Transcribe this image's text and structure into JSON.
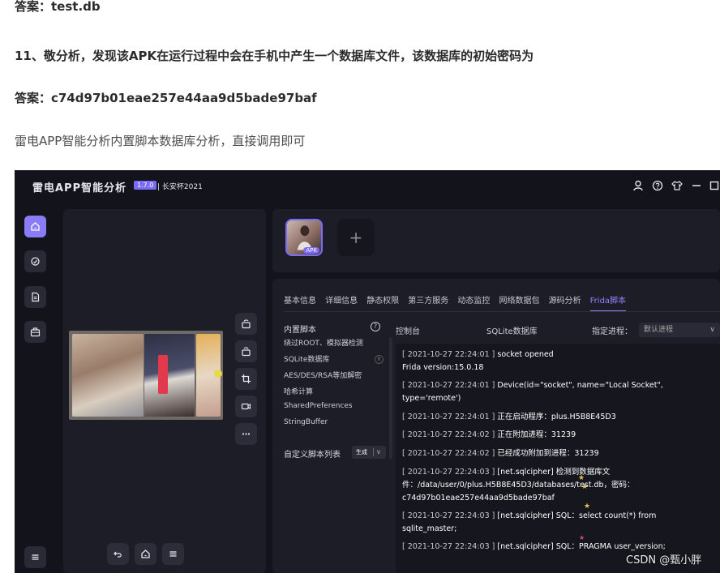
{
  "article": {
    "answer1": "答案：test.db",
    "question11": "11、敬分析，发现该APK在运行过程中会在手机中产生一个数据库文件，该数据库的初始密码为",
    "answer2": "答案：c74d97b01eae257e44aa9d5bade97baf",
    "note": "雷电APP智能分析内置脚本数据库分析，直接调用即可"
  },
  "app": {
    "title": "雷电APP智能分析",
    "version": "1.7.0",
    "edition": "| 长安杯2021",
    "window_icons": [
      "user-icon",
      "help-icon",
      "shirt-icon",
      "minimize-icon",
      "maximize-icon"
    ],
    "rail_icons": [
      "home-icon",
      "analysis-icon",
      "document-icon",
      "toolbox-icon",
      "menu-icon"
    ],
    "preview_tools": [
      "rotate-left-icon",
      "rotate-right-icon",
      "crop-icon",
      "record-icon",
      "more-icon"
    ],
    "preview_nav": [
      "back-icon",
      "home-icon",
      "menu-icon"
    ],
    "apk_tag": "APK",
    "add_symbol": "+",
    "tabs": [
      "基本信息",
      "详细信息",
      "静态权限",
      "第三方服务",
      "动态监控",
      "网络数据包",
      "源码分析",
      "Frida脚本"
    ],
    "active_tab": "Frida脚本",
    "script_panel": {
      "title": "内置脚本",
      "items": [
        "绕过ROOT、模拟器检测",
        "SQLite数据库",
        "AES/DES/RSA等加解密",
        "哈希计算",
        "SharedPreferences",
        "StringBuffer"
      ],
      "custom_label": "自定义脚本列表",
      "gen_button": "生成"
    },
    "console": {
      "label": "控制台",
      "sqlite_label": "SQLite数据库",
      "process_label": "指定进程：",
      "process_value": "默认进程",
      "logs": [
        {
          "ts": "[ 2021-10-27 22:24:01 ]",
          "text": "socket opened"
        },
        {
          "ts": "",
          "text": "Frida version:15.0.18"
        },
        {
          "ts": "[ 2021-10-27 22:24:01 ]",
          "text": "Device(id=\"socket\", name=\"Local Socket\","
        },
        {
          "ts": "",
          "text": "type='remote')"
        },
        {
          "ts": "[ 2021-10-27 22:24:01 ]",
          "text": "正在启动程序：plus.H5B8E45D3"
        },
        {
          "ts": "[ 2021-10-27 22:24:02 ]",
          "text": "正在附加进程：31239"
        },
        {
          "ts": "[ 2021-10-27 22:24:02 ]",
          "text": "已经成功附加到进程：31239"
        },
        {
          "ts": "[ 2021-10-27 22:24:03 ]",
          "text": "[net.sqlcipher] 检测到数据库文"
        },
        {
          "ts": "",
          "text": "件：/data/user/0/plus.H5B8E45D3/databases/test.db，密码："
        },
        {
          "ts": "",
          "text": "c74d97b01eae257e44aa9d5bade97baf"
        },
        {
          "ts": "[ 2021-10-27 22:24:03 ]",
          "text": "[net.sqlcipher] SQL：select count(*) from"
        },
        {
          "ts": "",
          "text": "sqlite_master;"
        },
        {
          "ts": "[ 2021-10-27 22:24:03 ]",
          "text": "[net.sqlcipher] SQL：PRAGMA user_version;"
        }
      ]
    }
  },
  "watermark": "CSDN @甄小胖"
}
